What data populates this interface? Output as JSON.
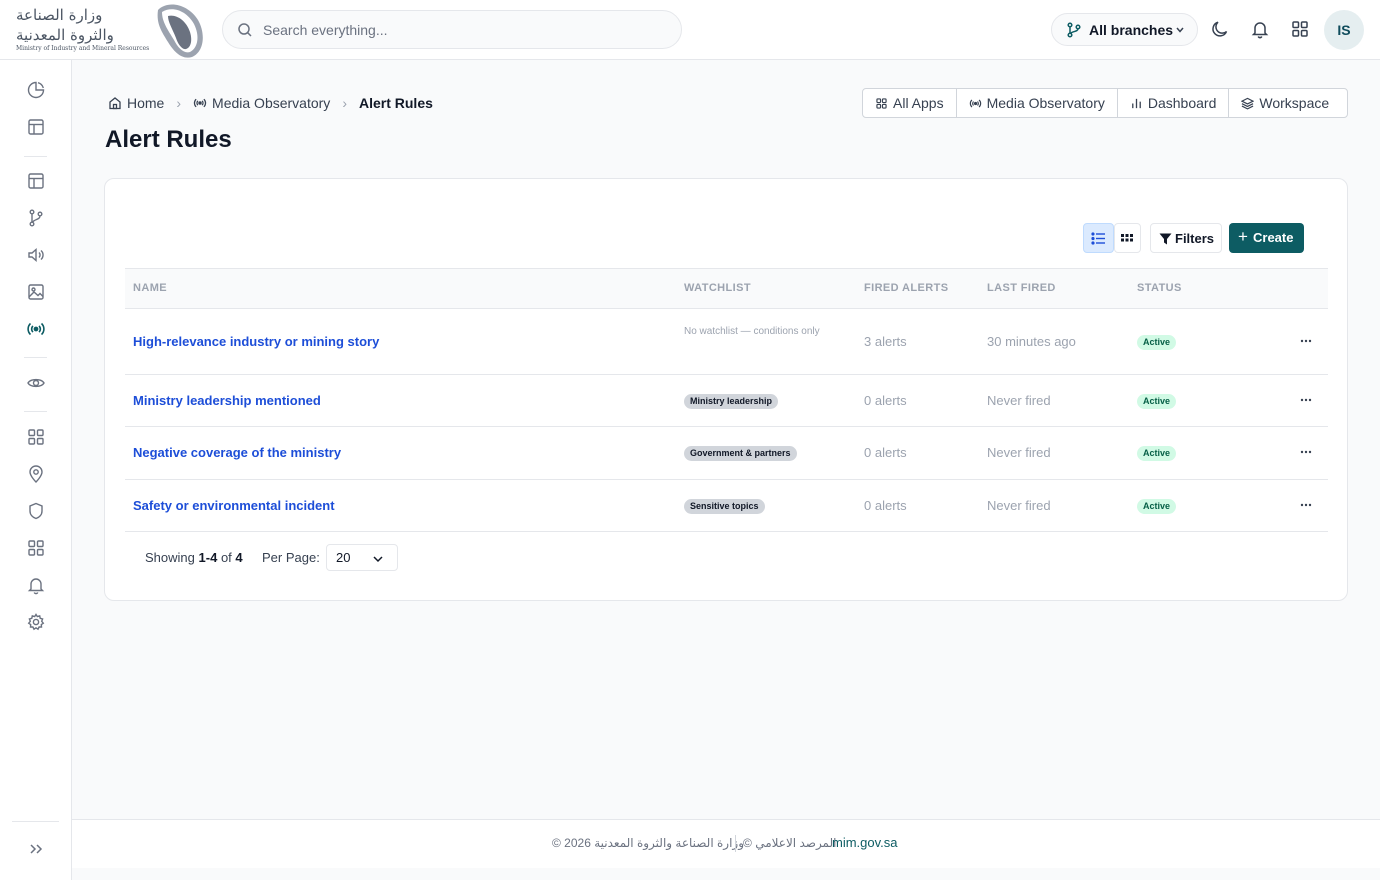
{
  "header": {
    "logo_ar_line1": "وزارة الصناعة",
    "logo_ar_line2": "والثروة المعدنية",
    "logo_en": "Ministry of Industry and Mineral Resources",
    "search_placeholder": "Search everything...",
    "branches_label": "All branches",
    "avatar_initials": "IS"
  },
  "breadcrumb": {
    "home": "Home",
    "section": "Media Observatory",
    "current": "Alert Rules"
  },
  "app_nav": [
    "All Apps",
    "Media Observatory",
    "Dashboard",
    "Workspace"
  ],
  "page": {
    "title": "Alert Rules"
  },
  "toolbar": {
    "filters_label": "Filters",
    "create_label": "Create"
  },
  "table": {
    "columns": [
      "NAME",
      "WATCHLIST",
      "FIRED ALERTS",
      "LAST FIRED",
      "STATUS"
    ],
    "rows": [
      {
        "name": "High-relevance industry or mining story",
        "watchlist": "No watchlist — conditions only",
        "watchlist_is_tag": false,
        "fired": "3 alerts",
        "last": "30 minutes ago",
        "status": "Active"
      },
      {
        "name": "Ministry leadership mentioned",
        "watchlist": "Ministry leadership",
        "watchlist_is_tag": true,
        "fired": "0 alerts",
        "last": "Never fired",
        "status": "Active"
      },
      {
        "name": "Negative coverage of the ministry",
        "watchlist": "Government & partners",
        "watchlist_is_tag": true,
        "fired": "0 alerts",
        "last": "Never fired",
        "status": "Active"
      },
      {
        "name": "Safety or environmental incident",
        "watchlist": "Sensitive topics",
        "watchlist_is_tag": true,
        "fired": "0 alerts",
        "last": "Never fired",
        "status": "Active"
      }
    ]
  },
  "pagination": {
    "showing_prefix": "Showing",
    "from": "1",
    "to": "4",
    "of_word": "of",
    "total": "4",
    "per_page_label": "Per Page:",
    "per_page_value": "20"
  },
  "footer": {
    "copyright": "© 2026 وزارة الصناعة والثروة المعدنية",
    "site_name": "© المرصد الاعلامي",
    "link": "mim.gov.sa"
  },
  "colors": {
    "brand": "#0d5c63",
    "link": "#1d4ed8",
    "active_bg": "#d1fae5",
    "active_text": "#065f46"
  }
}
